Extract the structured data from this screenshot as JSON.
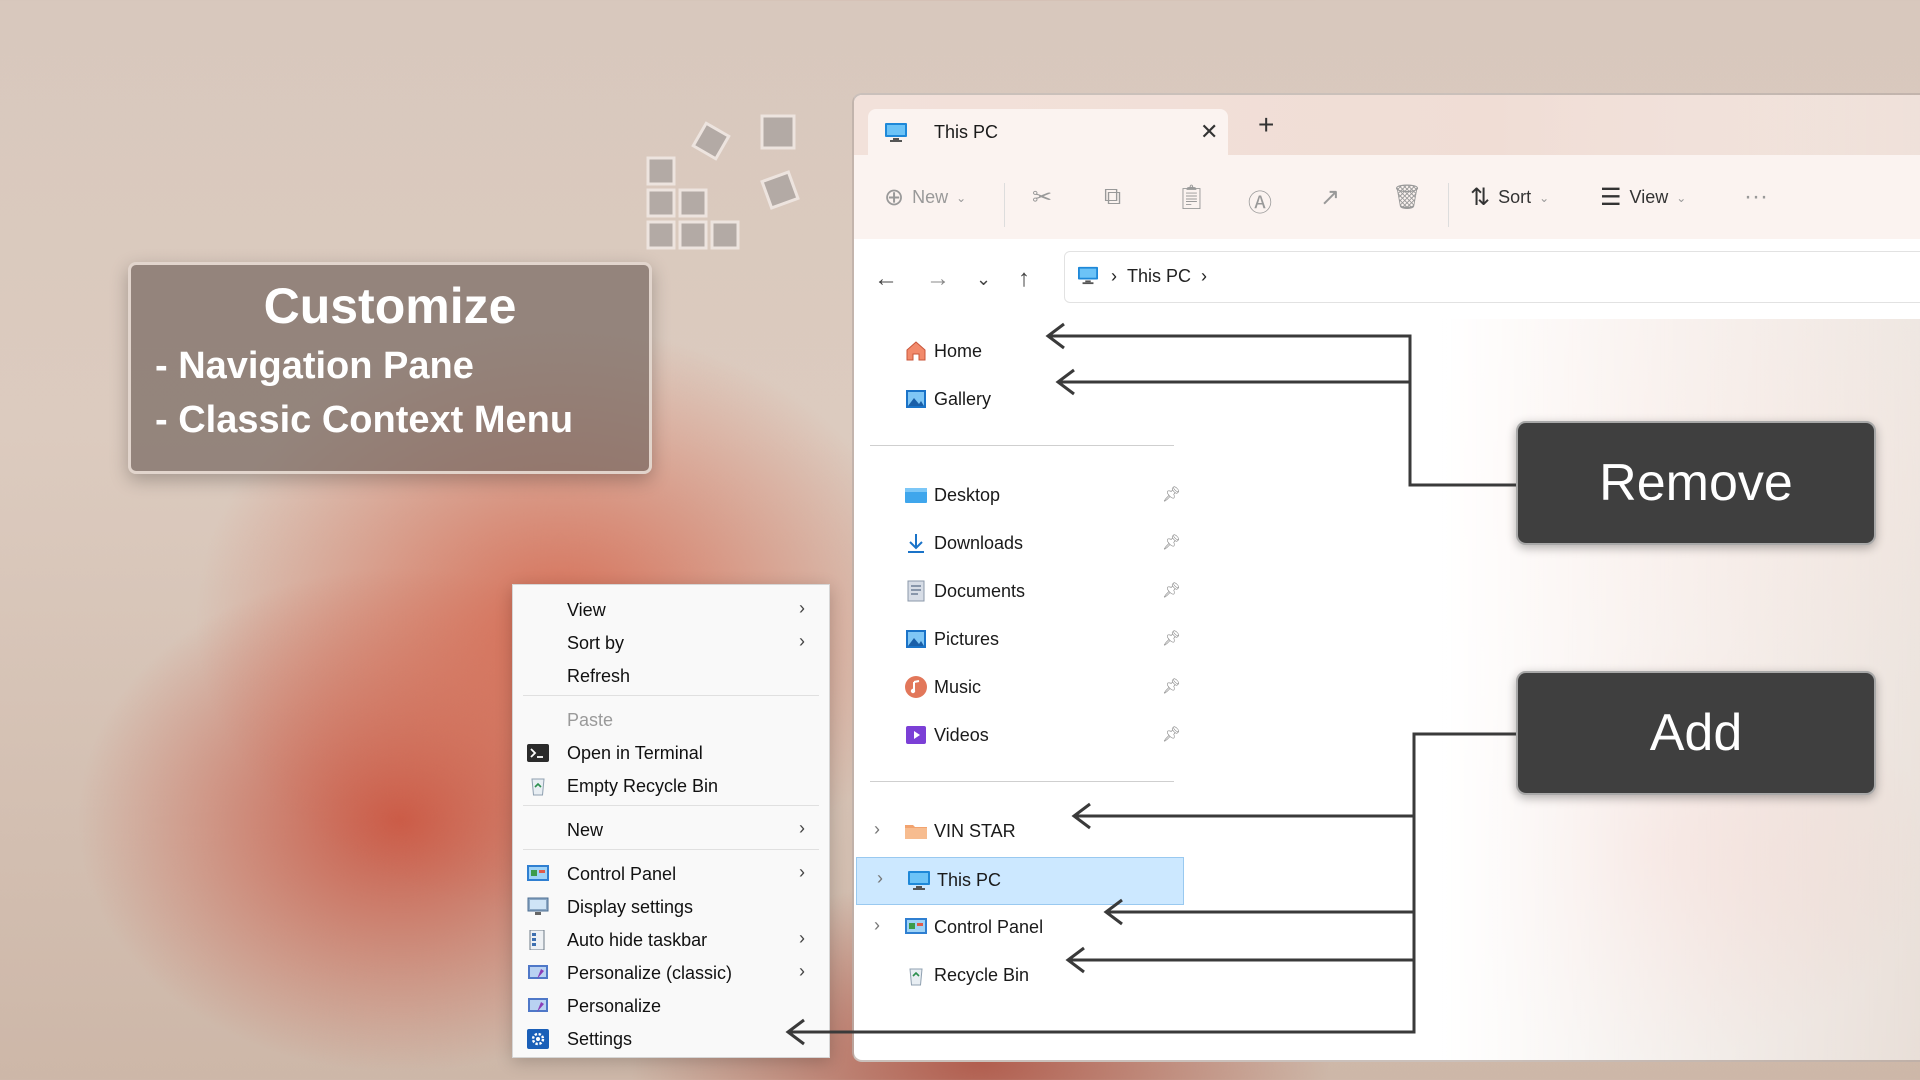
{
  "banner": {
    "title": "Customize",
    "line1": "- Navigation Pane",
    "line2": "- Classic Context Menu"
  },
  "explorer": {
    "tab_title": "This PC",
    "new_tab": "+",
    "close": "✕",
    "toolbar": {
      "new_label": "New",
      "sort_label": "Sort",
      "view_label": "View",
      "more": "···"
    },
    "address": {
      "crumb": "This PC"
    },
    "nav_pane": {
      "quick": [
        {
          "label": "Home",
          "icon": "home-icon"
        },
        {
          "label": "Gallery",
          "icon": "gallery-icon"
        }
      ],
      "pinned": [
        {
          "label": "Desktop",
          "icon": "desktop-folder-icon"
        },
        {
          "label": "Downloads",
          "icon": "downloads-icon"
        },
        {
          "label": "Documents",
          "icon": "documents-icon"
        },
        {
          "label": "Pictures",
          "icon": "pictures-icon"
        },
        {
          "label": "Music",
          "icon": "music-icon"
        },
        {
          "label": "Videos",
          "icon": "videos-icon"
        }
      ],
      "tree": [
        {
          "label": "VIN STAR",
          "icon": "user-folder-icon",
          "expandable": true
        },
        {
          "label": "This PC",
          "icon": "this-pc-icon",
          "expandable": true,
          "selected": true
        },
        {
          "label": "Control Panel",
          "icon": "control-panel-icon",
          "expandable": true
        },
        {
          "label": "Recycle Bin",
          "icon": "recycle-bin-icon",
          "expandable": false
        }
      ]
    }
  },
  "context_menu": {
    "items": [
      {
        "label": "View",
        "submenu": true
      },
      {
        "label": "Sort by",
        "submenu": true
      },
      {
        "label": "Refresh"
      },
      {
        "label": "Paste",
        "disabled": true
      },
      {
        "label": "Open in Terminal"
      },
      {
        "label": "Empty Recycle Bin"
      },
      {
        "label": "New",
        "submenu": true
      },
      {
        "label": "Control Panel",
        "submenu": true
      },
      {
        "label": "Display settings"
      },
      {
        "label": "Auto hide taskbar",
        "submenu": true
      },
      {
        "label": "Personalize (classic)",
        "submenu": true
      },
      {
        "label": "Personalize"
      },
      {
        "label": "Settings"
      }
    ]
  },
  "callouts": {
    "remove": "Remove",
    "add": "Add"
  },
  "colors": {
    "selection": "#cce8ff",
    "callout_bg": "#3f3f3f",
    "accent_blue": "#1a73c8"
  }
}
